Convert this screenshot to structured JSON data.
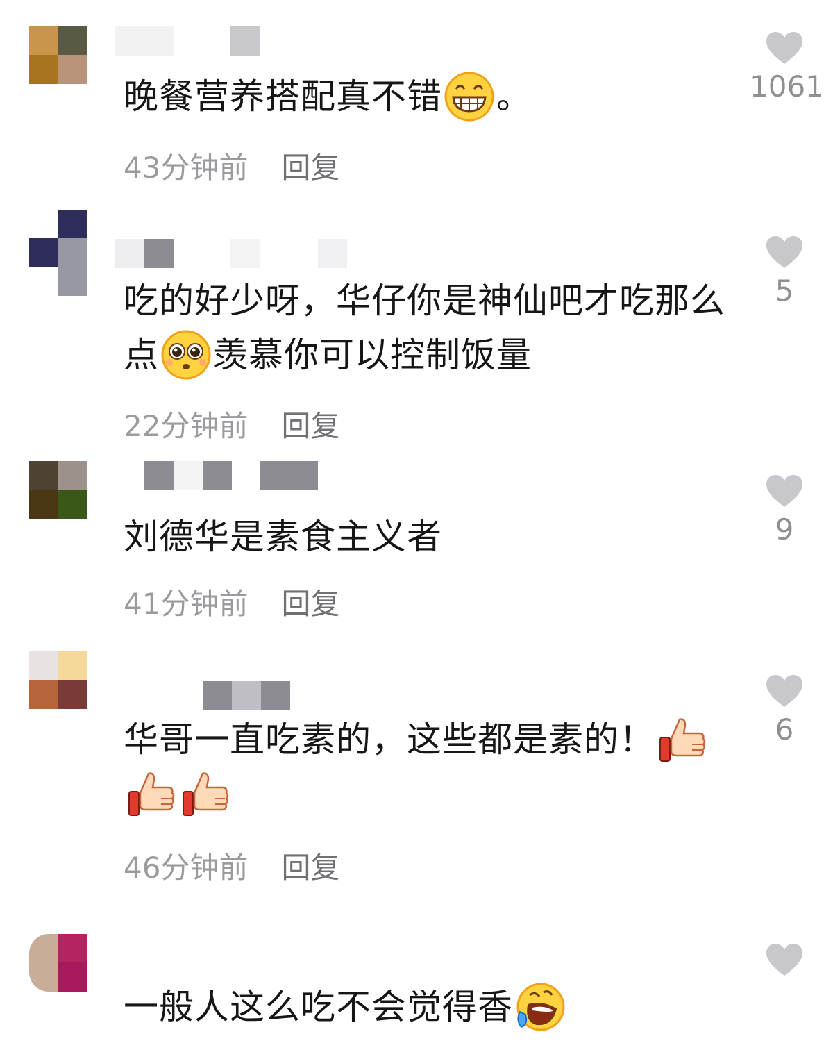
{
  "comments": [
    {
      "text_before": "晚餐营养搭配真不错",
      "emoji": "grinning-face",
      "text_after": "。",
      "time": "43分钟前",
      "reply": "回复",
      "likes": "1061",
      "avatar_colors": [
        "#c8964a",
        "#5a5a44",
        "#a97420",
        "#b8957a",
        "#ffffff",
        "#ffffff"
      ]
    },
    {
      "text_before": "吃的好少呀，华仔你是神仙吧才吃那么点",
      "emoji": "pleading-face",
      "text_after": "羡慕你可以控制饭量",
      "time": "22分钟前",
      "reply": "回复",
      "likes": "5",
      "avatar_colors": [
        "#ffffff",
        "#2e2c5a",
        "#2e2c5a",
        "#9898a4",
        "#ffffff",
        "#9898a4"
      ]
    },
    {
      "text_before": "刘德华是素食主义者",
      "emoji": "",
      "text_after": "",
      "time": "41分钟前",
      "reply": "回复",
      "likes": "9",
      "avatar_colors": [
        "#4e4232",
        "#9c918b",
        "#4a3814",
        "#3a5818",
        "#ffffff",
        "#ffffff"
      ]
    },
    {
      "text_before": "华哥一直吃素的，这些都是素的！",
      "emoji": "thumbs-up-x3",
      "text_after": "",
      "time": "46分钟前",
      "reply": "回复",
      "likes": "6",
      "avatar_colors": [
        "#e8e2e2",
        "#f5d99a",
        "#b6643a",
        "#7a3a36",
        "#ffffff",
        "#ffffff"
      ]
    },
    {
      "text_before": "一般人这么吃不会觉得香",
      "emoji": "rolling-laughing-face",
      "text_after": "",
      "time": "",
      "reply": "",
      "likes": "",
      "avatar_colors": [
        "#c8ad98",
        "#b42460",
        "#c8ad98",
        "#a81a5c",
        "#ffffff",
        "#ffffff"
      ]
    }
  ],
  "icons": {
    "like": "heart-icon",
    "like_color": "#c8c8cc"
  }
}
